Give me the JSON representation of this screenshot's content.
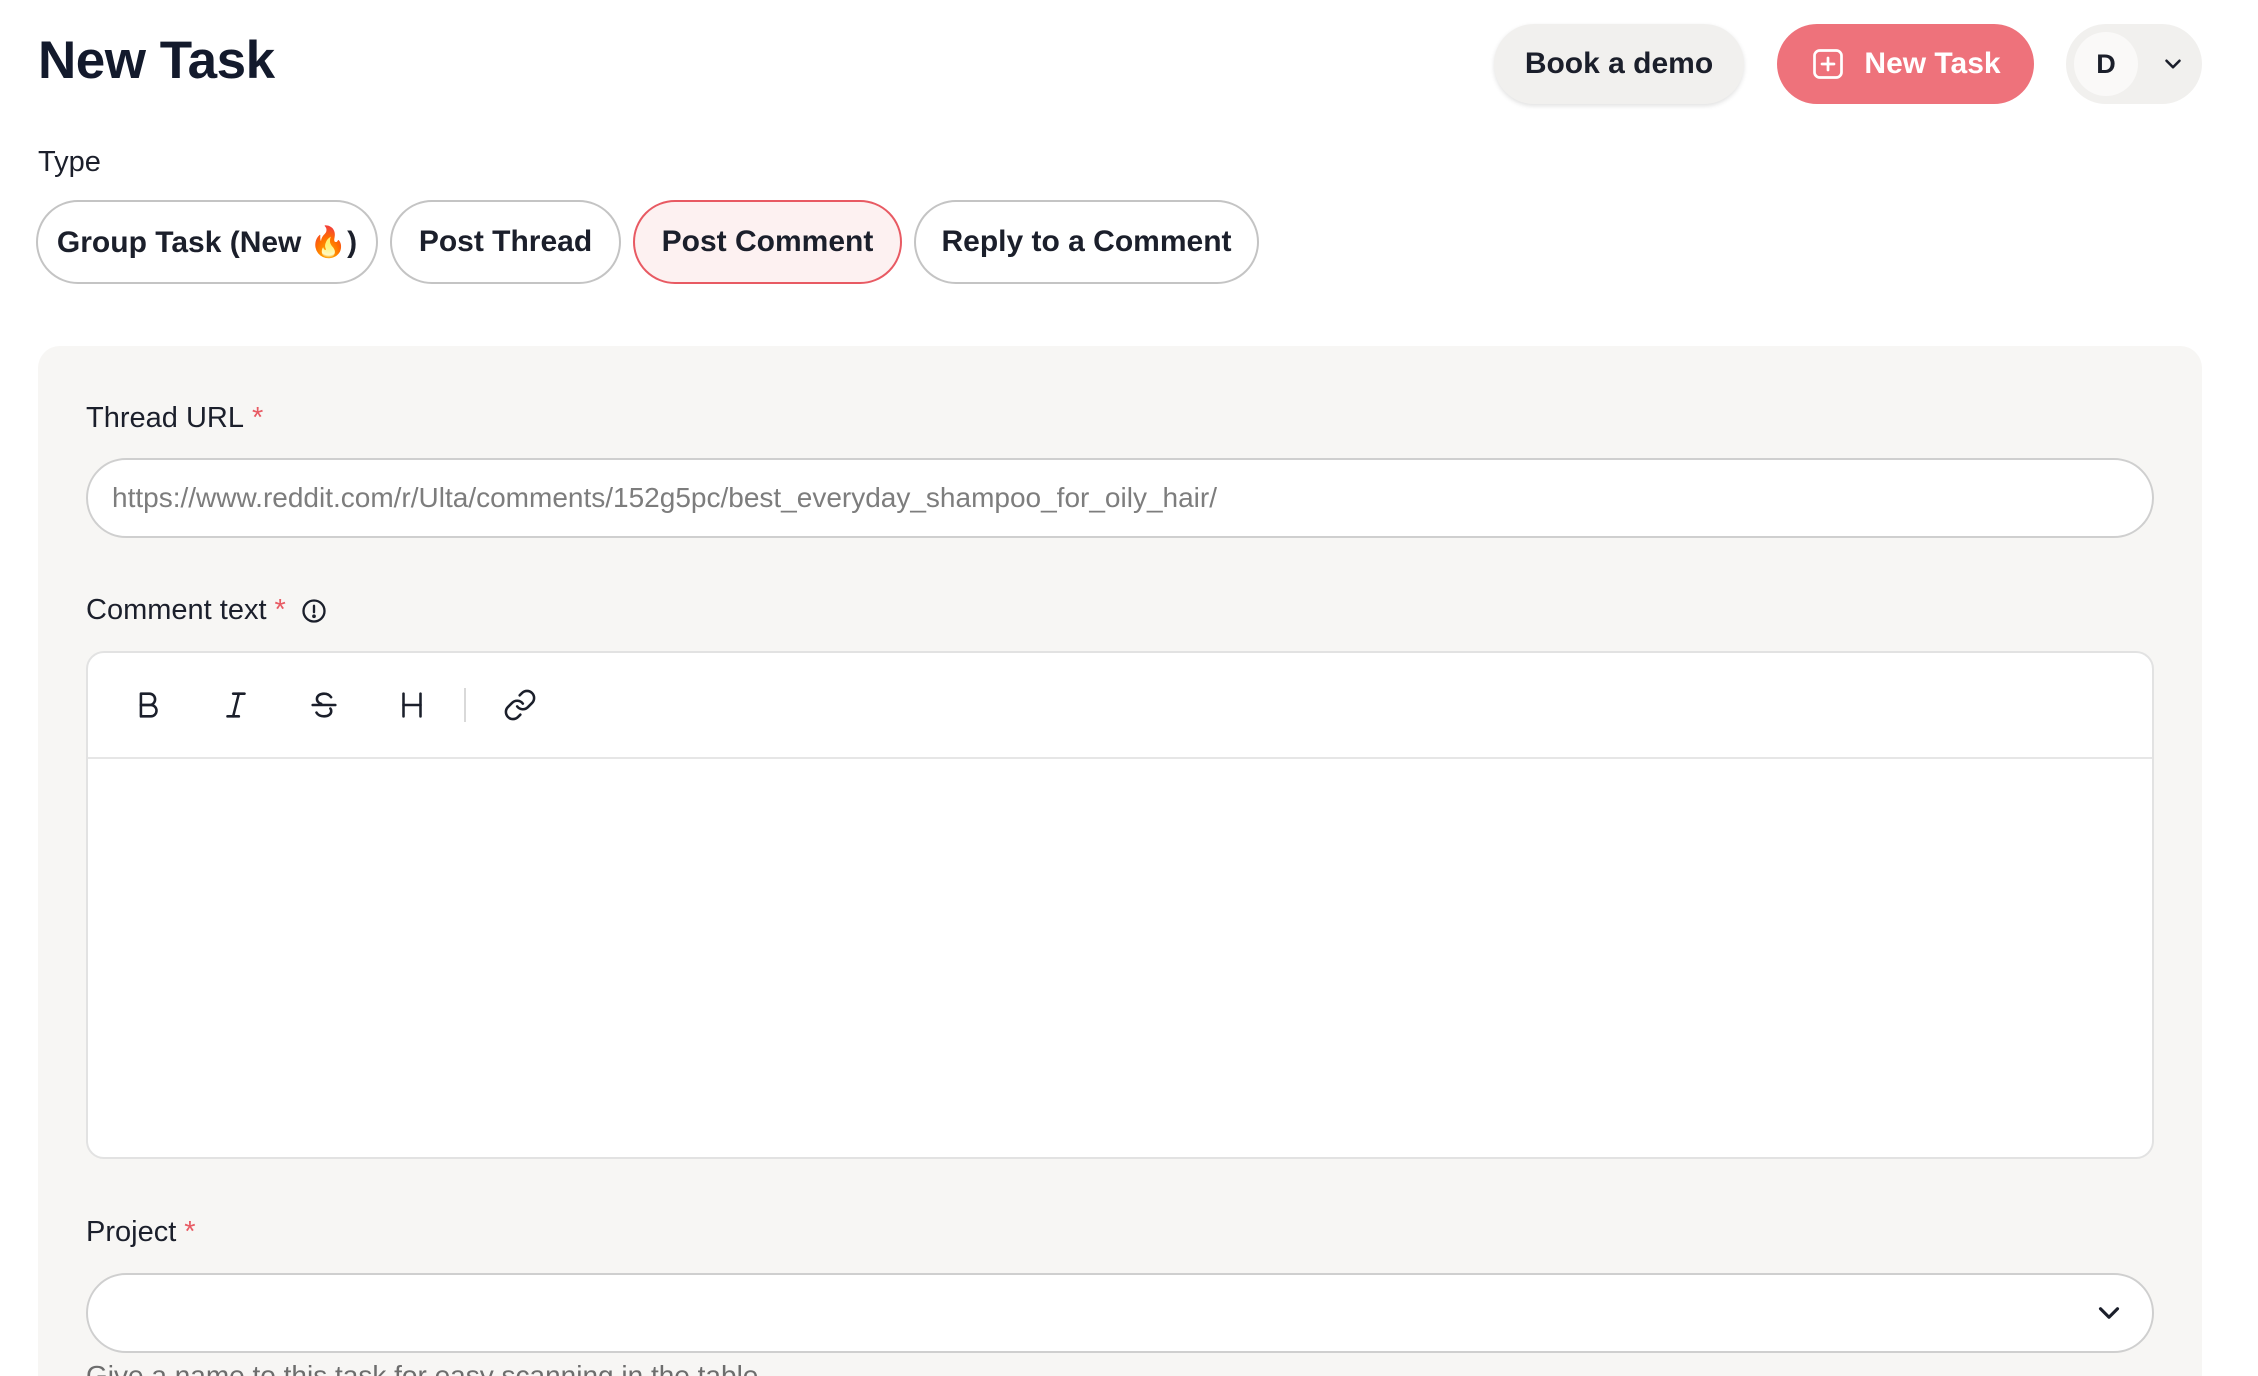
{
  "header": {
    "title": "New Task",
    "book_demo_label": "Book a demo",
    "new_task_label": "New Task",
    "avatar_initial": "D"
  },
  "type_selector": {
    "label": "Type",
    "options": [
      {
        "label": "Group Task (New 🔥)",
        "active": false
      },
      {
        "label": "Post Thread",
        "active": false
      },
      {
        "label": "Post Comment",
        "active": true
      },
      {
        "label": "Reply to a Comment",
        "active": false
      }
    ]
  },
  "form": {
    "thread_url": {
      "label": "Thread URL",
      "required_mark": "*",
      "value": "",
      "placeholder": "https://www.reddit.com/r/Ulta/comments/152g5pc/best_everyday_shampoo_for_oily_hair/"
    },
    "comment_text": {
      "label": "Comment text",
      "required_mark": "*",
      "toolbar": [
        "bold-icon",
        "italic-icon",
        "strikethrough-icon",
        "heading-icon",
        "link-icon"
      ],
      "value": ""
    },
    "project": {
      "label": "Project",
      "required_mark": "*",
      "selected": "",
      "hint": "Give a name to this task for easy scanning in the table"
    }
  },
  "colors": {
    "accent": "#ee727b",
    "active_border": "#e85a63",
    "active_bg": "#fdf1f1",
    "panel_bg": "#f7f6f4"
  }
}
